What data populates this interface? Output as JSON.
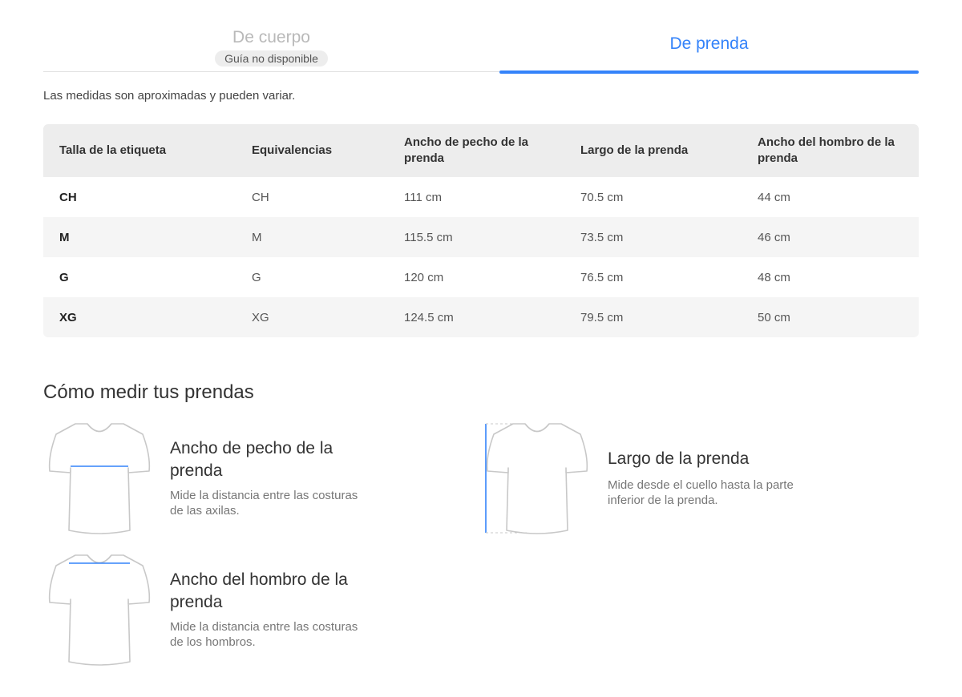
{
  "tabs": [
    {
      "label": "De cuerpo",
      "badge": "Guía no disponible",
      "active": false
    },
    {
      "label": "De prenda",
      "active": true
    }
  ],
  "disclaimer": "Las medidas son aproximadas y pueden variar.",
  "table": {
    "headers": [
      "Talla de la etiqueta",
      "Equivalencias",
      "Ancho de pecho de la prenda",
      "Largo de la prenda",
      "Ancho del hombro de la prenda"
    ],
    "rows": [
      [
        "CH",
        "CH",
        "111 cm",
        "70.5 cm",
        "44 cm"
      ],
      [
        "M",
        "M",
        "115.5 cm",
        "73.5 cm",
        "46 cm"
      ],
      [
        "G",
        "G",
        "120 cm",
        "76.5 cm",
        "48 cm"
      ],
      [
        "XG",
        "XG",
        "124.5 cm",
        "79.5 cm",
        "50 cm"
      ]
    ]
  },
  "how_to": {
    "title": "Cómo medir tus prendas",
    "items": [
      {
        "title": "Ancho de pecho de la prenda",
        "description": "Mide la distancia entre las costuras de las axilas.",
        "icon": "tshirt-chest-icon"
      },
      {
        "title": "Largo de la prenda",
        "description": "Mide desde el cuello hasta la parte inferior de la prenda.",
        "icon": "tshirt-length-icon"
      },
      {
        "title": "Ancho del hombro de la prenda",
        "description": "Mide la distancia entre las costuras de los hombros.",
        "icon": "tshirt-shoulder-icon"
      }
    ]
  },
  "colors": {
    "accent": "#3483fa",
    "header_bg": "#ededed",
    "row_alt_bg": "#f5f5f5"
  }
}
